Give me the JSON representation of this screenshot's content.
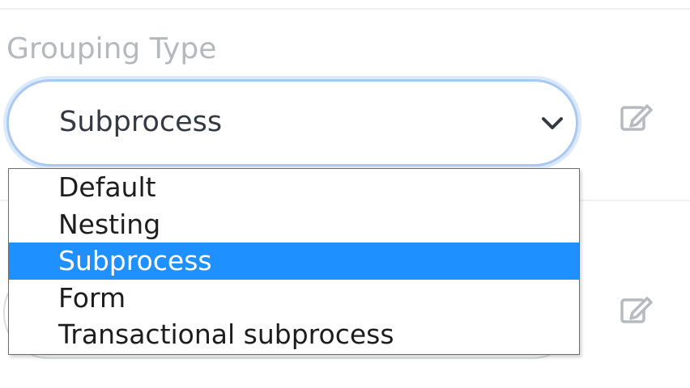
{
  "field": {
    "label": "Grouping Type",
    "selected_value": "Subprocess"
  },
  "dropdown": {
    "options": [
      "Default",
      "Nesting",
      "Subprocess",
      "Form",
      "Transactional subprocess"
    ],
    "selected_index": 2
  },
  "icons": {
    "chevron": "chevron-down-icon",
    "edit": "edit-icon"
  },
  "colors": {
    "highlight": "#1e90ff",
    "focus_ring": "#a9c9f2",
    "label": "#b5b9be"
  }
}
